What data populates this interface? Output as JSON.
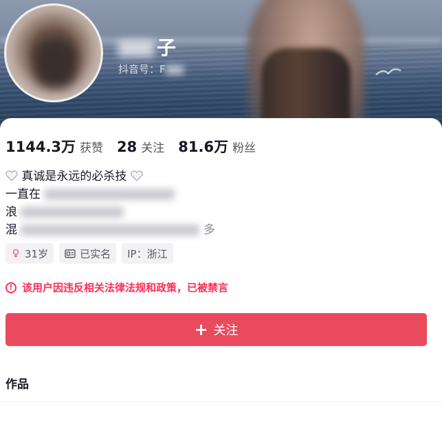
{
  "profile": {
    "name_visible": "子",
    "handle_prefix": "抖音号：F"
  },
  "stats": [
    {
      "value": "1144.3万",
      "label": "获赞"
    },
    {
      "value": "28",
      "label": "关注"
    },
    {
      "value": "81.6万",
      "label": "粉丝"
    }
  ],
  "bio": {
    "line1": "真诚是永远的必杀技",
    "line2_prefix": "一直在",
    "line3_prefix": "浪",
    "line4_prefix": "混",
    "line4_suffix": "多"
  },
  "tags": {
    "age": "31岁",
    "verified": "已实名",
    "ip": "IP：浙江"
  },
  "warning": "该用户因违反相关法律法规和政策，已被禁言",
  "follow_button": "关注",
  "works_title": "作品",
  "colors": {
    "accent": "#ea4a5d",
    "warning": "#fe2c55"
  }
}
